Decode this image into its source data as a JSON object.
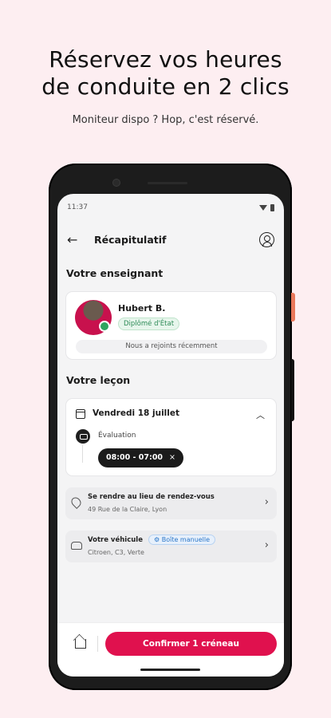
{
  "promo": {
    "headline_line1": "Réservez vos heures",
    "headline_line2": "de conduite en 2 clics",
    "tagline": "Moniteur dispo ? Hop, c'est réservé."
  },
  "statusbar": {
    "time": "11:37"
  },
  "appbar": {
    "title": "Récapitulatif"
  },
  "teacher_section": {
    "title": "Votre enseignant",
    "name": "Hubert B.",
    "badge": "Diplômé d'État",
    "joined": "Nous a rejoints récemment"
  },
  "lesson_section": {
    "title": "Votre leçon",
    "date": "Vendredi 18 juillet",
    "type": "Évaluation",
    "time_slot": "08:00 - 07:00"
  },
  "meeting": {
    "title": "Se rendre au lieu de rendez-vous",
    "address": "49 Rue de la Claire, Lyon"
  },
  "vehicle": {
    "title": "Votre véhicule",
    "gearbox": "Boîte manuelle",
    "details": "Citroen, C3, Verte"
  },
  "actions": {
    "confirm_label": "Confirmer 1 créneau"
  },
  "colors": {
    "accent": "#e0114e",
    "success": "#2e8b57",
    "info": "#2b77c9"
  }
}
